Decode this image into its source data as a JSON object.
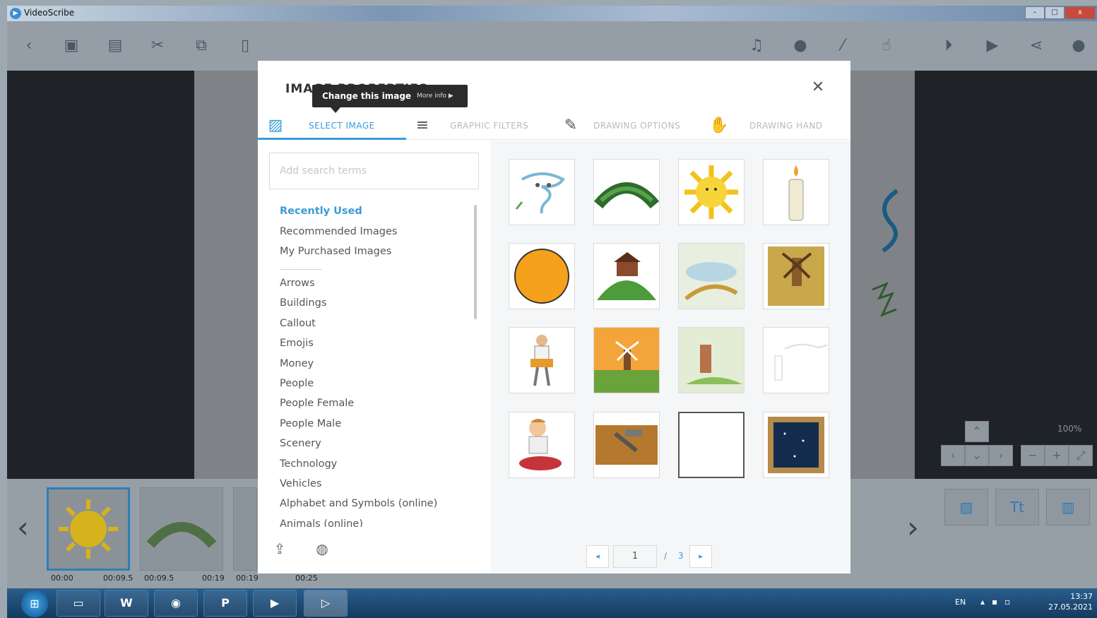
{
  "window": {
    "title": "VideoScribe",
    "buttons": [
      "–",
      "□",
      "x"
    ]
  },
  "toolbar": {
    "left_icons": [
      "back-icon",
      "save-icon",
      "save-as-icon",
      "cut-icon",
      "copy-icon",
      "paste-icon"
    ],
    "right_icons": [
      "music-icon",
      "microphone-icon",
      "brush-icon",
      "hand-icon",
      "play-from-icon",
      "play-icon",
      "share-icon",
      "help-icon"
    ]
  },
  "canvas": {
    "zoom": "100%"
  },
  "timeline": {
    "times": [
      "00:00",
      "00:09.5",
      "00:09.5",
      "00:19",
      "00:19",
      "00:25"
    ]
  },
  "modal": {
    "title": "IMAGE PROPERTIES",
    "tooltip": {
      "text": "Change this image",
      "more": "More info ▶"
    },
    "tabs": [
      {
        "label": "SELECT IMAGE",
        "icon": "image-icon",
        "active": true
      },
      {
        "label": "GRAPHIC FILTERS",
        "icon": "filters-icon",
        "active": false
      },
      {
        "label": "DRAWING OPTIONS",
        "icon": "pencil-icon",
        "active": false
      },
      {
        "label": "DRAWING HAND",
        "icon": "hand-icon",
        "active": false
      }
    ],
    "search": {
      "placeholder": "Add search terms",
      "value": ""
    },
    "categories_top": [
      "Recently Used",
      "Recommended Images",
      "My Purchased Images"
    ],
    "categories": [
      "Arrows",
      "Buildings",
      "Callout",
      "Emojis",
      "Money",
      "People",
      "People Female",
      "People Male",
      "Scenery",
      "Technology",
      "Vehicles",
      "Alphabet and Symbols (online)",
      "Animals (online)"
    ],
    "active_category": "Recently Used",
    "images": [
      "tornado",
      "grass-mound",
      "sun",
      "candle",
      "orange-ball",
      "house-on-hill",
      "windmill-landscape",
      "windmill-painting",
      "farmer",
      "windmill-sunset",
      "windmill-village",
      "blank-sketch",
      "boy-sitting",
      "hammer-wood",
      "blank",
      "window-night-sky"
    ],
    "pagination": {
      "current": "1",
      "separator": "/",
      "total": "3"
    }
  },
  "taskbar": {
    "apps": [
      "explorer-icon",
      "word-icon",
      "chrome-icon",
      "powerpoint-icon",
      "media-icon",
      "videoscribe-icon"
    ],
    "lang": "EN",
    "time": "13:37",
    "date": "27.05.2021"
  },
  "colors": {
    "accent": "#3a9bd9",
    "modal_bg": "#ffffff",
    "overlay": "#1f2327"
  }
}
